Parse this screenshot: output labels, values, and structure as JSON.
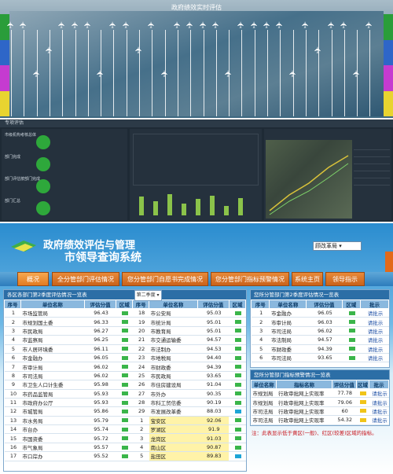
{
  "panel1": {
    "title": "政府绩效实时评估",
    "brand": "",
    "bar_colors": [
      "#2a9d3a",
      "#2e66c8",
      "#c53bd0",
      "#e8d430"
    ],
    "bar_colors_right": [
      "#2a9d3a",
      "#2e66c8",
      "#c53bd0",
      "#e8d430"
    ]
  },
  "panel2": {
    "header": "专项评估",
    "rows": [
      "市级机构考核总体",
      "部门完成",
      "部门评估按部门完成",
      "部门汇总"
    ]
  },
  "panel3": {
    "brand_line1": "政府绩效评估与管理",
    "brand_line2": "市领导查询系统",
    "select_value": "顾改革局 ▾",
    "side_tag": "",
    "tabs": [
      "概况",
      "全分管部门评估情况",
      "您分管部门自愿书完成情况",
      "您分管部门指标预警情况",
      "系统主页",
      "领导指示"
    ],
    "left_box": {
      "title": "各区各部门第2季度评估情况一览表",
      "dropdown": "第二季度 ▾",
      "headers": [
        "序号",
        "单位名称",
        "评估分值",
        "区域",
        "序号",
        "单位名称",
        "评估分值",
        "区域"
      ],
      "rows_left": [
        [
          "1",
          "市场监管局",
          "96.43"
        ],
        [
          "2",
          "市规划国土委",
          "96.33"
        ],
        [
          "3",
          "市民政局",
          "96.27"
        ],
        [
          "4",
          "市监察局",
          "96.25"
        ],
        [
          "5",
          "市人居环境委",
          "96.11"
        ],
        [
          "6",
          "市金融办",
          "96.05"
        ],
        [
          "7",
          "市审计局",
          "96.02"
        ],
        [
          "8",
          "市司法局",
          "96.02"
        ],
        [
          "9",
          "市卫生人口计生委",
          "95.98"
        ],
        [
          "10",
          "市药品监管局",
          "95.93"
        ],
        [
          "11",
          "市政府办公厅",
          "95.93"
        ],
        [
          "12",
          "市城管局",
          "95.86"
        ],
        [
          "13",
          "市水务局",
          "95.79"
        ],
        [
          "14",
          "市台办",
          "95.74"
        ],
        [
          "15",
          "市国资委",
          "95.72"
        ],
        [
          "16",
          "市气象局",
          "95.57"
        ],
        [
          "17",
          "市口岸办",
          "95.52"
        ]
      ],
      "rows_right": [
        [
          "18",
          "市公安局",
          "95.03"
        ],
        [
          "19",
          "市统计局",
          "95.01"
        ],
        [
          "20",
          "市教育局",
          "95.01"
        ],
        [
          "21",
          "市交通运输委",
          "94.57"
        ],
        [
          "22",
          "市法制办",
          "94.53"
        ],
        [
          "23",
          "市地税局",
          "94.40"
        ],
        [
          "24",
          "市财政委",
          "94.39"
        ],
        [
          "25",
          "市民政局",
          "93.65"
        ],
        [
          "26",
          "市住房建设局",
          "91.04"
        ],
        [
          "27",
          "市外办",
          "90.35"
        ],
        [
          "28",
          "市科工贸信委",
          "90.19"
        ],
        [
          "29",
          "市发展改革委",
          "88.03"
        ],
        [
          "1",
          "宝安区",
          "92.06"
        ],
        [
          "2",
          "罗湖区",
          "91.9"
        ],
        [
          "3",
          "龙岗区",
          "91.03"
        ],
        [
          "4",
          "南山区",
          "90.87"
        ],
        [
          "5",
          "盐田区",
          "89.83"
        ]
      ],
      "highlight_index": [
        12,
        13,
        14,
        15,
        16
      ]
    },
    "right_box1": {
      "title": "您所分管部门第2季度评估情况一览表",
      "headers": [
        "序号",
        "单位名称",
        "评估分值",
        "区域",
        "批示"
      ],
      "rows": [
        [
          "1",
          "市金融办",
          "96.05",
          "请批示"
        ],
        [
          "2",
          "市审计局",
          "96.03",
          "请批示"
        ],
        [
          "3",
          "市司法局",
          "96.02",
          "请批示"
        ],
        [
          "4",
          "市法制局",
          "94.57",
          "请批示"
        ],
        [
          "5",
          "市财政委",
          "94.39",
          "请批示"
        ],
        [
          "6",
          "市司法局",
          "93.65",
          "请批示"
        ]
      ]
    },
    "right_box2": {
      "title": "您所分管部门指标预警情况一览表",
      "headers": [
        "单位名称",
        "指标名称",
        "评估分值",
        "区域",
        "批示"
      ],
      "rows": [
        [
          "市规划局",
          "行政审批网上实现率",
          "77.78",
          "请批示"
        ],
        [
          "市规划局",
          "行政审批网上实现率",
          "79.06",
          "请批示"
        ],
        [
          "市司法局",
          "行政审批网上实现率",
          "60",
          "请批示"
        ],
        [
          "市司法局",
          "行政审批网上实现率",
          "54.32",
          "请批示"
        ]
      ]
    },
    "note": "注：此表显示低于黄区(一般)、红区(较差)区域的指标。"
  }
}
